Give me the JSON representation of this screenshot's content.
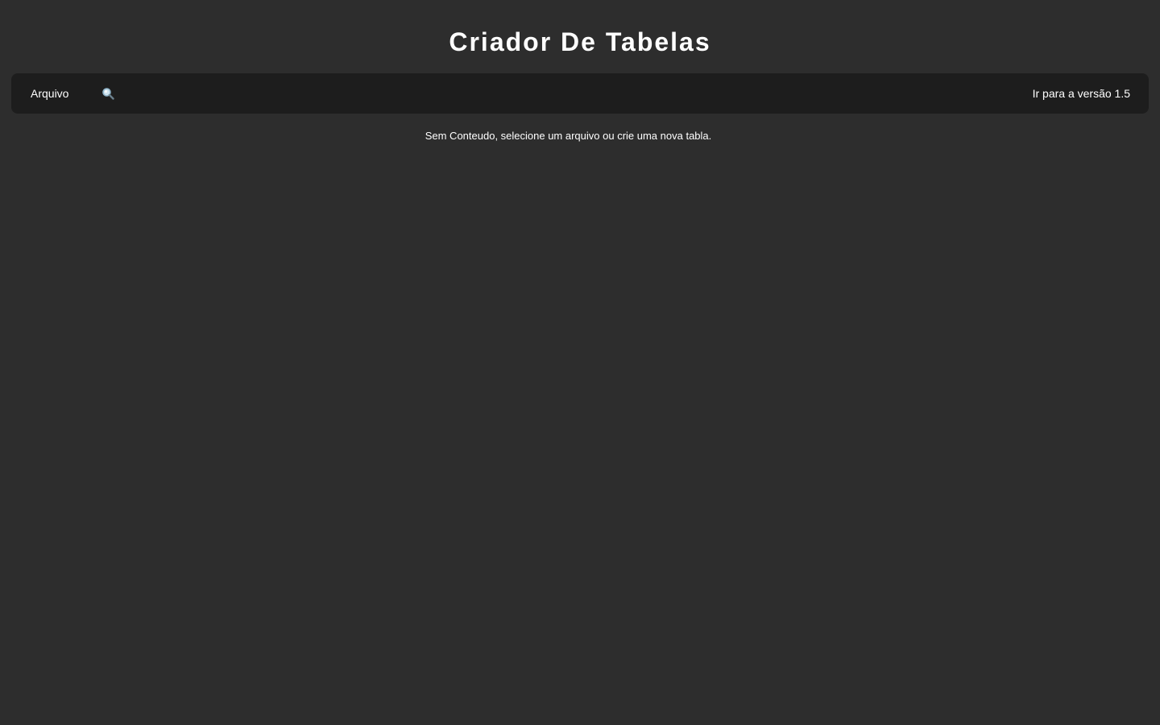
{
  "header": {
    "title": "Criador De Tabelas"
  },
  "toolbar": {
    "menu_file_label": "Arquivo",
    "search_icon": "search-icon",
    "version_link_label": "Ir para a versão 1.5"
  },
  "main": {
    "empty_message": "Sem Conteudo, selecione um arquivo ou crie uma nova tabla."
  },
  "colors": {
    "background": "#2d2d2d",
    "toolbar": "#1d1d1d",
    "text": "#ffffff",
    "search_icon_handle": "#8fb4c9"
  }
}
